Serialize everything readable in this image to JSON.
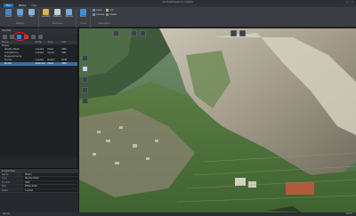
{
  "window": {
    "title": "ContextCapture Viewer"
  },
  "ribbon_tabs": [
    "File",
    "Home",
    "View"
  ],
  "ribbon_groups": [
    {
      "name": "Display",
      "buttons": [
        "Select",
        "Orbit",
        "Pan"
      ]
    },
    {
      "name": "Measure",
      "buttons": [
        "Location",
        "Distance",
        "Volume"
      ]
    },
    {
      "name": "Tools",
      "buttons": [
        "Export"
      ]
    },
    {
      "name": "Navigation",
      "small": [
        "Layer",
        "Camera",
        "Sun",
        "Shade"
      ]
    }
  ],
  "left_panel": {
    "title": "Spatial",
    "columns": [
      "Name",
      "State",
      "Type",
      "Info"
    ],
    "rows": [
      {
        "name": "Scene",
        "state": "",
        "type": "",
        "info": ""
      },
      {
        "name": "Reality Mesh",
        "state": "Loaded",
        "type": "Mesh",
        "info": "3MX"
      },
      {
        "name": "Annotations",
        "state": "Loaded",
        "type": "Vector",
        "info": "KML"
      },
      {
        "name": "Measurements",
        "state": "",
        "type": "",
        "info": ""
      },
      {
        "name": "Terrain",
        "state": "Loaded",
        "type": "Raster",
        "info": "DEM"
      },
      {
        "name": "Model",
        "state": "Selected",
        "type": "Mesh",
        "info": "3MX"
      }
    ]
  },
  "properties": {
    "title": "Properties",
    "rows": [
      {
        "key": "Name",
        "value": "Model"
      },
      {
        "key": "Type",
        "value": "Reality Mesh"
      },
      {
        "key": "Format",
        "value": "3MX"
      },
      {
        "key": "SRS",
        "value": "EPSG:4326"
      },
      {
        "key": "State",
        "value": "Loaded"
      }
    ]
  },
  "viewport_tools": [
    "select",
    "home",
    "measure",
    "layers",
    "export",
    "settings"
  ],
  "status": {
    "left": "Ready",
    "right": "100%"
  },
  "colors": {
    "accent": "#1f6fb5",
    "highlight": "#e0261b"
  }
}
